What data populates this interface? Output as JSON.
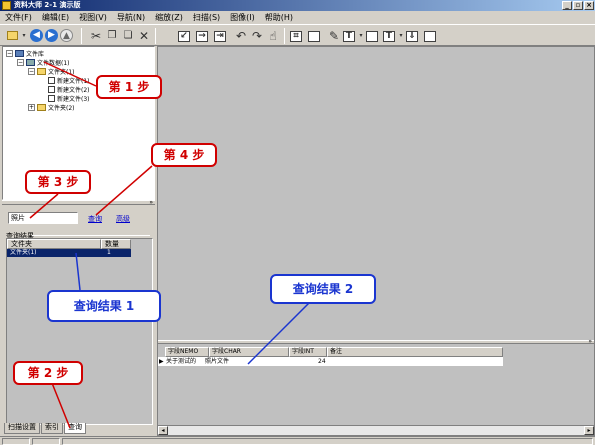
{
  "window": {
    "title": "资料大师 2-1 演示版",
    "buttons": [
      "_",
      "▫",
      "×"
    ]
  },
  "menu": [
    "文件(F)",
    "编辑(E)",
    "视图(V)",
    "导航(N)",
    "缩放(Z)",
    "扫描(S)",
    "图像(I)",
    "帮助(H)"
  ],
  "tree": {
    "root": "文件库",
    "db": "文件数据(1)",
    "folder1": "文件夹(1)",
    "files": [
      "新建文件(1)",
      "新建文件(2)",
      "新建文件(3)"
    ],
    "folder2": "文件夹(2)"
  },
  "search": {
    "value": "照片",
    "query_label": "查询",
    "advanced_label": "高级",
    "result_group": "查询结果",
    "columns": [
      "文件夹",
      "数量"
    ],
    "rows": [
      {
        "folder": "文件夹(1)",
        "count": "1"
      }
    ]
  },
  "bottom_tabs": [
    "扫描设置",
    "索引",
    "查询"
  ],
  "result_grid": {
    "columns": [
      "字段NEMO",
      "字段CHAR",
      "字段INT",
      "备注"
    ],
    "row": {
      "memo": "关于测试的",
      "char": "照片文件",
      "int": "24",
      "note": ""
    }
  },
  "callouts": {
    "step1": "第 1 步",
    "step2": "第 2 步",
    "step3": "第 3 步",
    "step4": "第 4 步",
    "result1": "查询结果 1",
    "result2": "查询结果 2"
  },
  "colors": {
    "title_bar": "#0a246a",
    "selection": "#0a246a",
    "callout_red": "#d00000",
    "callout_blue": "#1a35d0",
    "link": "#0000cc"
  }
}
